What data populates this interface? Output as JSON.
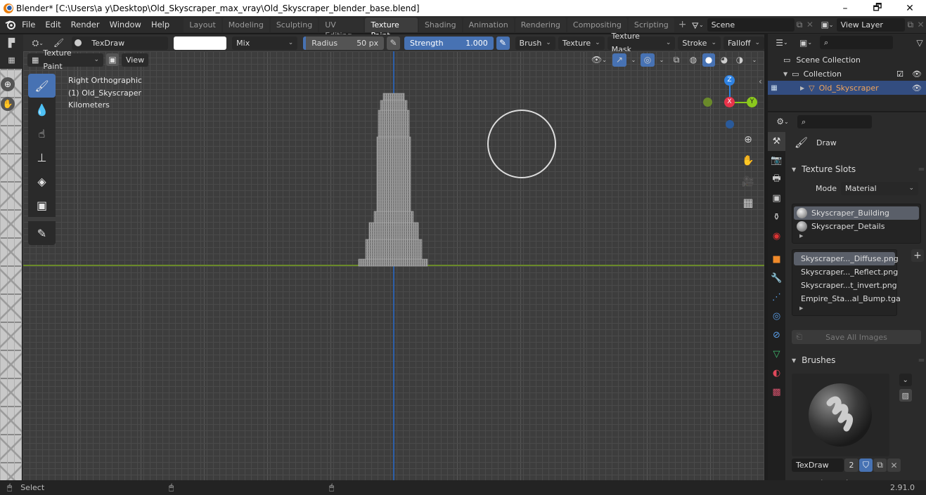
{
  "window": {
    "title": "Blender* [C:\\Users\\a y\\Desktop\\Old_Skyscraper_max_vray\\Old_Skyscraper_blender_base.blend]",
    "controls": {
      "minimize": "–",
      "maximize": "🗗",
      "close": "✕"
    }
  },
  "menubar": {
    "items": [
      "File",
      "Edit",
      "Render",
      "Window",
      "Help"
    ]
  },
  "workspaces": {
    "tabs": [
      "Layout",
      "Modeling",
      "Sculpting",
      "UV Editing",
      "Texture Paint",
      "Shading",
      "Animation",
      "Rendering",
      "Compositing",
      "Scripting"
    ],
    "active": "Texture Paint",
    "add_label": "+"
  },
  "scene": {
    "value": "Scene"
  },
  "view_layer": {
    "value": "View Layer"
  },
  "tool_settings": {
    "brush_name": "TexDraw",
    "color": "#ffffff",
    "blend_mode": "Mix",
    "radius_label": "Radius",
    "radius_value": "50 px",
    "strength_label": "Strength",
    "strength_value": "1.000",
    "menus": [
      "Brush",
      "Texture",
      "Texture Mask",
      "Stroke",
      "Falloff"
    ]
  },
  "view_header": {
    "mode": "Texture Paint",
    "view_label": "View"
  },
  "viewport": {
    "overlay_lines": [
      "Right Orthographic",
      "(1) Old_Skyscraper",
      "Kilometers"
    ],
    "gizmo": {
      "z": "Z",
      "x": "X",
      "y": "Y",
      "colors": {
        "x": "#e8334a",
        "y": "#8bc81d",
        "z": "#2f83e3"
      }
    }
  },
  "toolbar": {
    "tools": [
      "draw-icon",
      "soften-icon",
      "smear-icon",
      "clone-icon",
      "fill-icon",
      "mask-icon",
      "annotate-icon"
    ]
  },
  "outliner": {
    "search_placeholder": "",
    "items": [
      {
        "label": "Scene Collection",
        "level": 0
      },
      {
        "label": "Collection",
        "level": 1
      },
      {
        "label": "Old_Skyscraper",
        "level": 2,
        "selected": true
      }
    ]
  },
  "properties": {
    "active_tool": "Draw",
    "texture_slots": {
      "title": "Texture Slots",
      "mode_label": "Mode",
      "mode_value": "Material",
      "materials": [
        "Skyscraper_Building",
        "Skyscraper_Details"
      ],
      "images": [
        {
          "name": "Skyscraper..._Diffuse.png",
          "color": "#9a9a9a"
        },
        {
          "name": "Skyscraper..._Reflect.png",
          "color": "#555555"
        },
        {
          "name": "Skyscraper...t_invert.png",
          "color": "#ffffff"
        },
        {
          "name": "Empire_Sta...al_Bump.tga",
          "color": "#7b7bff"
        }
      ],
      "save_all_label": "Save All Images"
    },
    "brushes": {
      "title": "Brushes",
      "brush_name": "TexDraw",
      "users": "2"
    },
    "brush_settings_title": "Brush Settings"
  },
  "statusbar": {
    "select_label": "Select",
    "version": "2.91.0"
  },
  "colors": {
    "accent": "#4772b3",
    "selection": "#334d80",
    "object_name": "#f0a35a"
  }
}
